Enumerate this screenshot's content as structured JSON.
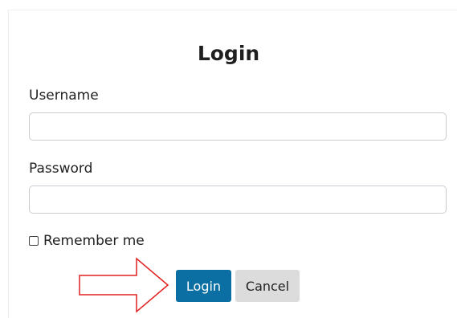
{
  "form": {
    "title": "Login",
    "username_label": "Username",
    "username_value": "",
    "password_label": "Password",
    "password_value": "",
    "remember_label": "Remember me",
    "remember_checked": false,
    "login_button": "Login",
    "cancel_button": "Cancel"
  },
  "annotation": {
    "icon": "right-arrow-outline-icon",
    "color": "#e02020"
  },
  "colors": {
    "primary_button": "#0b6fa4",
    "secondary_button": "#dcdcdc"
  }
}
